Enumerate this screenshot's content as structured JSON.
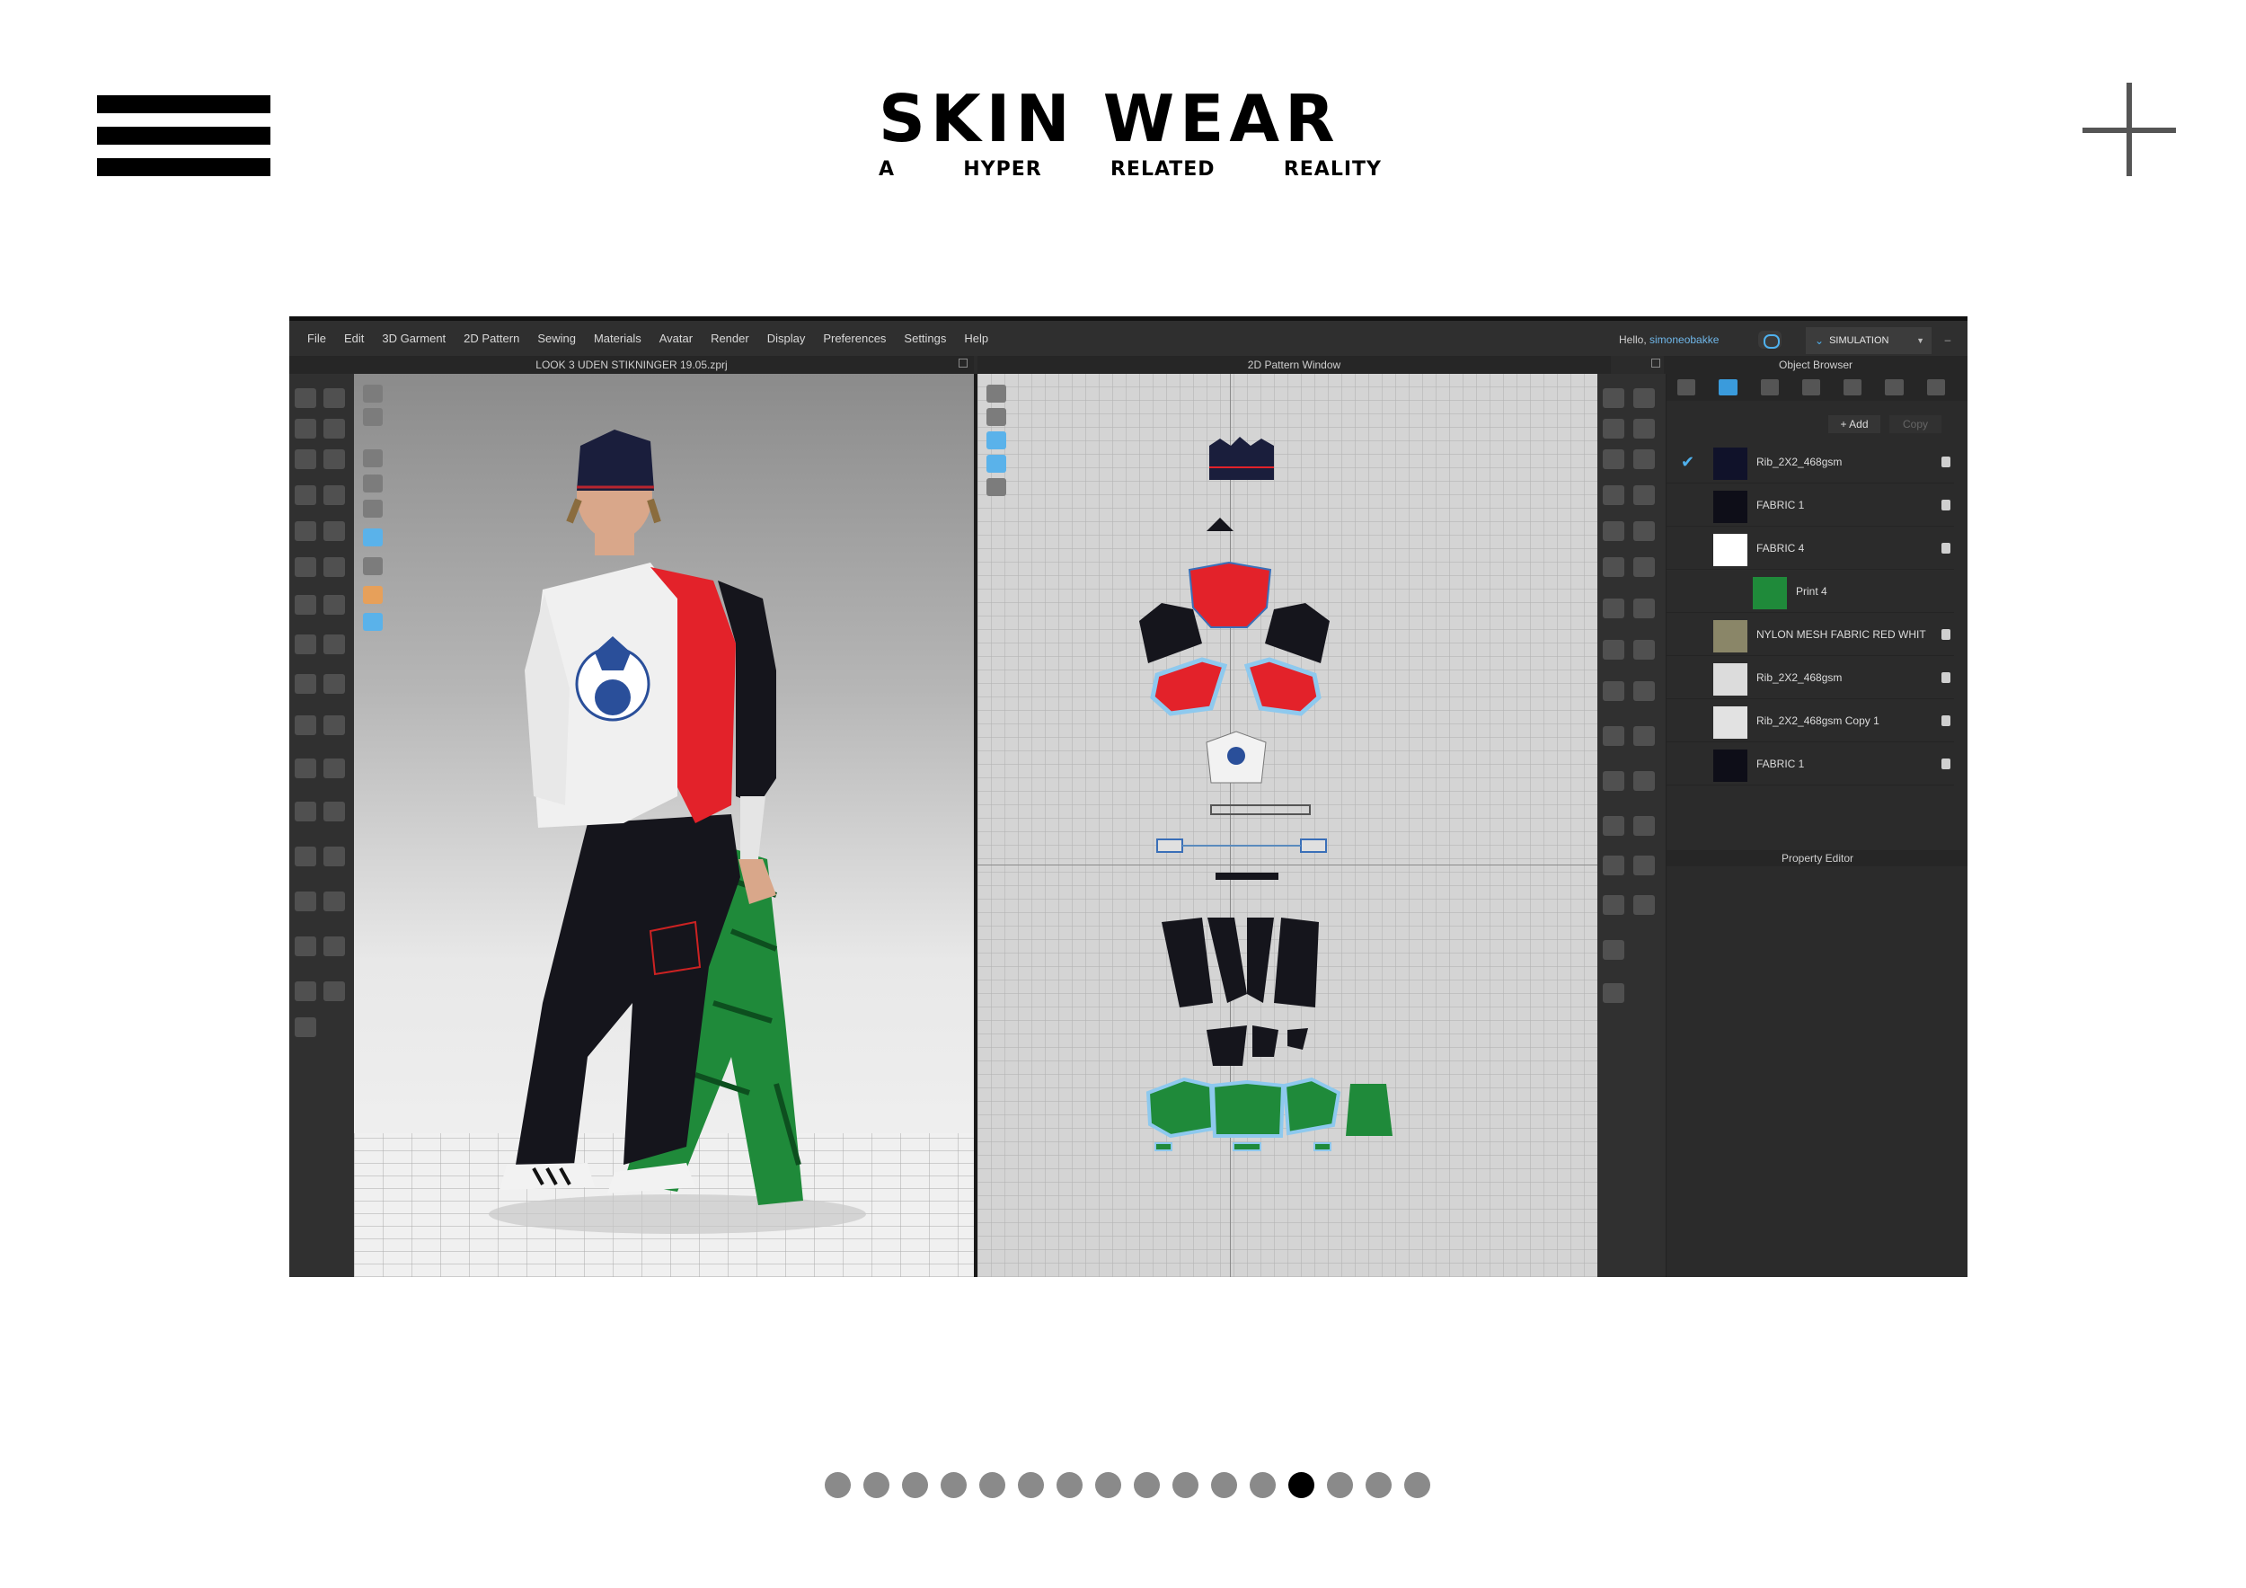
{
  "header": {
    "menu_icon": "hamburger-icon",
    "close_icon": "plus-icon",
    "logo_title": "SKIN WEAR",
    "logo_sub": [
      "A",
      "HYPER",
      "RELATED",
      "REALITY"
    ]
  },
  "app": {
    "menu": [
      "File",
      "Edit",
      "3D Garment",
      "2D Pattern",
      "Sewing",
      "Materials",
      "Avatar",
      "Render",
      "Display",
      "Preferences",
      "Settings",
      "Help"
    ],
    "hello_prefix": "Hello, ",
    "username": "simoneobakke",
    "mode_button": "SIMULATION",
    "window_3d_title": "LOOK 3 UDEN STIKNINGER 19.05.zprj",
    "window_2d_title": "2D Pattern Window",
    "object_browser_title": "Object Browser",
    "add_label": "+ Add",
    "copy_label": "Copy",
    "property_editor_title": "Property Editor",
    "fabrics": [
      {
        "label": "Rib_2X2_468gsm",
        "color": "#10122a",
        "checked": true,
        "sub": false
      },
      {
        "label": "FABRIC 1",
        "color": "#0e0e18",
        "checked": false,
        "sub": false
      },
      {
        "label": "FABRIC 4",
        "color": "#ffffff",
        "checked": false,
        "sub": false
      },
      {
        "label": "Print 4",
        "color": "#1f8a3a",
        "checked": false,
        "sub": true
      },
      {
        "label": "NYLON MESH FABRIC RED WHIT",
        "color": "#8a8668",
        "checked": false,
        "sub": false
      },
      {
        "label": "Rib_2X2_468gsm",
        "color": "#dcdcdc",
        "checked": false,
        "sub": false
      },
      {
        "label": "Rib_2X2_468gsm Copy 1",
        "color": "#e2e2e2",
        "checked": false,
        "sub": false
      },
      {
        "label": "FABRIC 1",
        "color": "#0e0e18",
        "checked": false,
        "sub": false
      }
    ]
  },
  "carousel": {
    "total": 16,
    "active_index": 12
  },
  "colors": {
    "accent": "#4fb1ee",
    "red": "#e3222a",
    "navy": "#10122a",
    "green": "#1f8a3a"
  }
}
